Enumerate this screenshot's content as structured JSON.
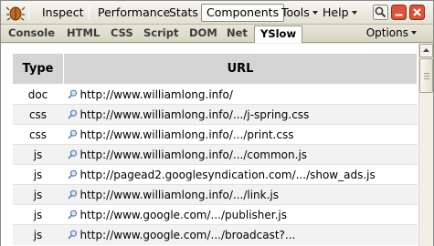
{
  "toolbar": {
    "inspect": "Inspect",
    "performance": "Performance",
    "stats": "Stats",
    "components": "Components",
    "tools": "Tools",
    "help": "Help"
  },
  "tabs": [
    "Console",
    "HTML",
    "CSS",
    "Script",
    "DOM",
    "Net",
    "YSlow"
  ],
  "options": "Options",
  "table": {
    "headers": {
      "type": "Type",
      "url": "URL"
    },
    "rows": [
      {
        "type": "doc",
        "url": "http://www.williamlong.info/"
      },
      {
        "type": "css",
        "url": "http://www.williamlong.info/.../j-spring.css"
      },
      {
        "type": "css",
        "url": "http://www.williamlong.info/.../print.css"
      },
      {
        "type": "js",
        "url": "http://www.williamlong.info/.../common.js"
      },
      {
        "type": "js",
        "url": "http://pagead2.googlesyndication.com/.../show_ads.js"
      },
      {
        "type": "js",
        "url": "http://www.williamlong.info/.../link.js"
      },
      {
        "type": "js",
        "url": "http://www.google.com/.../publisher.js"
      },
      {
        "type": "js",
        "url": "http://www.google.com/.../broadcast?..."
      }
    ]
  },
  "icons": {
    "app": "firebug-bug-icon",
    "search": "search-icon",
    "minimize": "minimize-icon",
    "close": "close-icon",
    "url": "magnifier-icon"
  },
  "colors": {
    "header_bg": "#d4d4d4",
    "alt_row": "#f2f2f2",
    "chrome": "#ece9d8"
  }
}
